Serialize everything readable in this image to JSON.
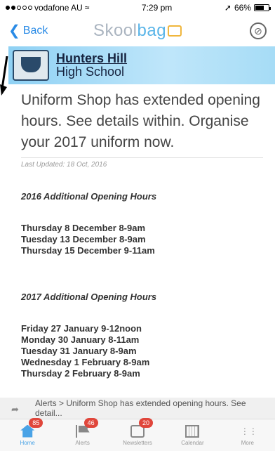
{
  "status": {
    "carrier": "vodafone AU",
    "time": "7:29 pm",
    "battery": "66%",
    "battery_level": 0.66
  },
  "nav": {
    "back_label": "Back",
    "brand_prefix": "Skool",
    "brand_suffix": "bag"
  },
  "school": {
    "line1": "Hunters Hill",
    "line2": "High School"
  },
  "article": {
    "title": "Uniform Shop has extended opening hours. See details within. Organise your 2017 uniform now.",
    "updated": "Last Updated: 18 Oct, 2016",
    "sections": [
      {
        "heading": "2016 Additional Opening Hours",
        "lines": [
          "Thursday 8 December 8-9am",
          "Tuesday 13 December 8-9am",
          "Thursday 15 December 9-11am"
        ]
      },
      {
        "heading": "2017 Additional Opening Hours",
        "lines": [
          "Friday 27 January 9-12noon",
          "Monday 30 January 8-11am",
          "Tuesday 31 January 8-9am",
          "Wednesday 1 February 8-9am",
          "Thursday 2 February 8-9am"
        ]
      }
    ]
  },
  "alert_bar": {
    "text": "Alerts > Uniform Shop has extended opening hours. See detail..."
  },
  "tabs": [
    {
      "label": "Home",
      "badge": "85",
      "icon": "home-icon",
      "active": true
    },
    {
      "label": "Alerts",
      "badge": "46",
      "icon": "flag-icon",
      "active": false
    },
    {
      "label": "Newsletters",
      "badge": "20",
      "icon": "newsletter-icon",
      "active": false
    },
    {
      "label": "Calendar",
      "badge": "",
      "icon": "calendar-icon",
      "active": false
    },
    {
      "label": "More",
      "badge": "",
      "icon": "more-icon",
      "active": false
    }
  ],
  "colors": {
    "accent": "#2a8be6",
    "badge": "#e0463b",
    "banner": "#8fd1f4"
  }
}
